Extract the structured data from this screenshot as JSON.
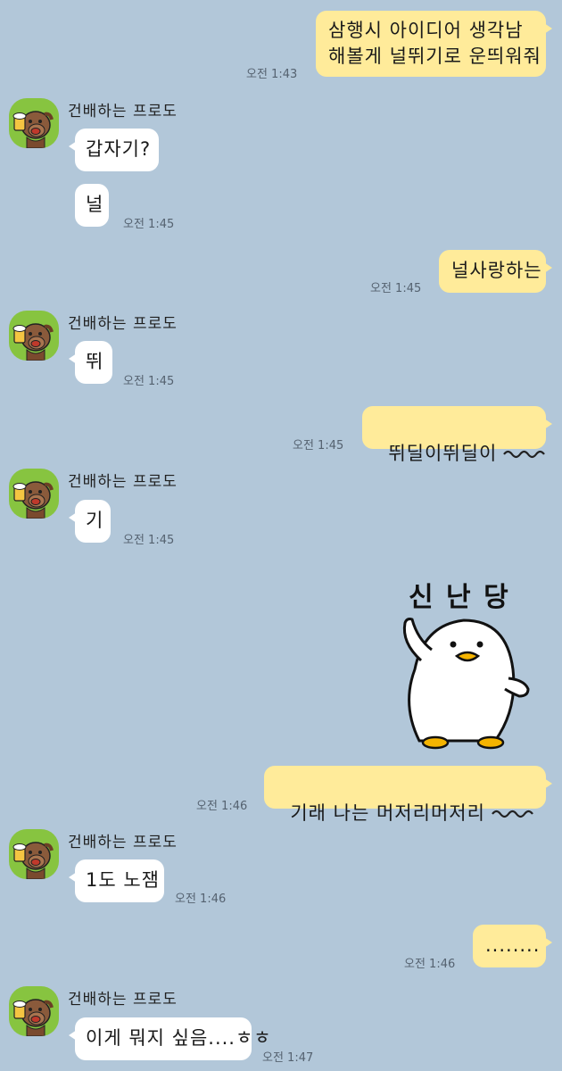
{
  "colors": {
    "background": "#b2c7d9",
    "my_bubble": "#ffeb9a",
    "their_bubble": "#ffffff",
    "avatar_bg": "#87c440"
  },
  "contact": {
    "name": "건배하는 프로도",
    "avatar_icon": "frodo-beer-avatar-icon"
  },
  "messages": [
    {
      "sender": "me",
      "text": "삼행시 아이디어 생각남\n해볼게 널뛰기로 운띄워줘",
      "time": "오전 1:43"
    },
    {
      "sender": "other",
      "text": "갑자기?"
    },
    {
      "sender": "other",
      "text": "널",
      "time": "오전 1:45"
    },
    {
      "sender": "me",
      "text": "널사랑하는",
      "time": "오전 1:45"
    },
    {
      "sender": "other",
      "text": "뛰",
      "time": "오전 1:45"
    },
    {
      "sender": "me",
      "text": "뛰딜이뛰딜이",
      "time": "오전 1:45",
      "icon": "squiggle-icon"
    },
    {
      "sender": "other",
      "text": "기",
      "time": "오전 1:45"
    },
    {
      "sender": "me",
      "type": "sticker",
      "text": "신 난 당",
      "icon": "dancing-duck-sticker-icon"
    },
    {
      "sender": "me",
      "text": "기래 나는 머저리머저리",
      "time": "오전 1:46",
      "icon": "squiggle-icon"
    },
    {
      "sender": "other",
      "text": "1도 노잼",
      "time": "오전 1:46"
    },
    {
      "sender": "me",
      "text": "........",
      "time": "오전 1:46"
    },
    {
      "sender": "other",
      "text": "이게 뭐지 싶음....ㅎㅎ",
      "time": "오전 1:47"
    }
  ]
}
